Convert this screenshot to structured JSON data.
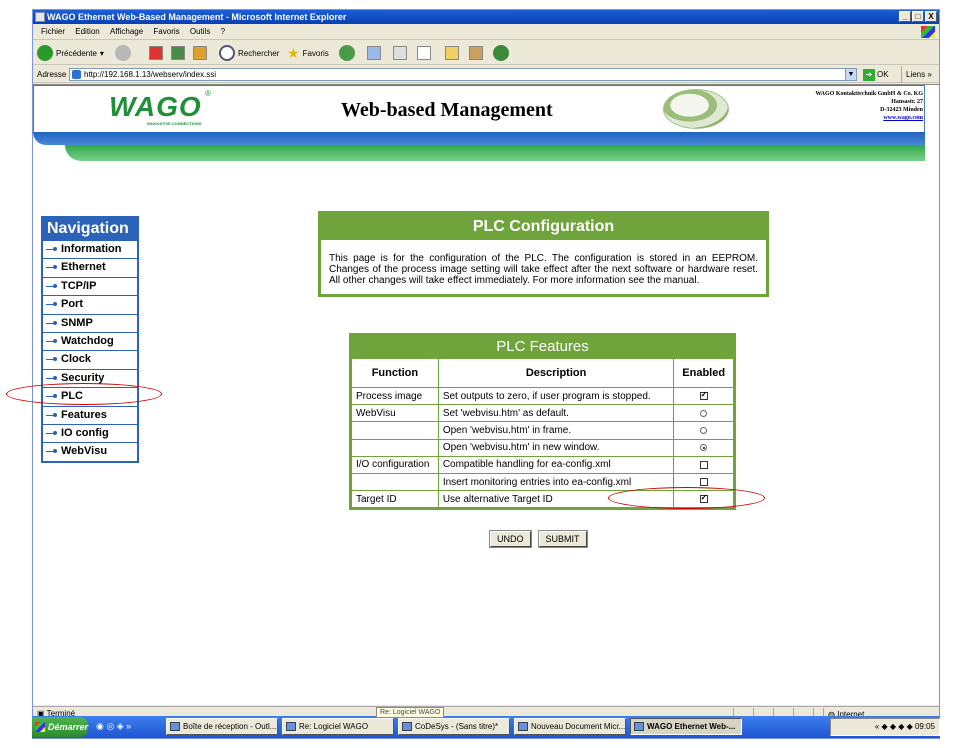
{
  "window": {
    "title": "WAGO Ethernet Web-Based Management - Microsoft Internet Explorer",
    "controls": [
      "_",
      "□",
      "X"
    ]
  },
  "menu": [
    "Fichier",
    "Edition",
    "Affichage",
    "Favoris",
    "Outils",
    "?"
  ],
  "toolbar": {
    "back": "Précédente",
    "search": "Rechercher",
    "favorites": "Favoris"
  },
  "address": {
    "label": "Adresse",
    "url": "http://192.168.1.13/webserv/index.ssi",
    "go": "OK",
    "links": "Liens"
  },
  "header": {
    "logo": "WAGO",
    "logo_sub": "INNOVATIVE CONNECTIONS",
    "registered": "®",
    "title": "Web-based Management",
    "company": "WAGO Kontakttechnik GmbH & Co. KG",
    "street": "Hansastr. 27",
    "city": "D-32423 Minden",
    "web": "www.wago.com"
  },
  "nav": {
    "title": "Navigation",
    "items": [
      "Information",
      "Ethernet",
      "TCP/IP",
      "Port",
      "SNMP",
      "Watchdog",
      "Clock",
      "Security",
      "PLC",
      "Features",
      "IO config",
      "WebVisu"
    ]
  },
  "config": {
    "title": "PLC Configuration",
    "description": "This page is for the configuration of the PLC. The configuration is stored in an EEPROM. Changes of the process image setting will take effect after the next software or hardware reset. All other changes will take effect immediately. For more information see the manual."
  },
  "features": {
    "title": "PLC Features",
    "columns": [
      "Function",
      "Description",
      "Enabled"
    ],
    "rows": [
      {
        "function": "Process image",
        "description": "Set outputs to zero, if user program is stopped.",
        "control": "checkbox",
        "checked": true
      },
      {
        "function": "WebVisu",
        "description": "Set 'webvisu.htm' as default.",
        "control": "radio",
        "checked": false
      },
      {
        "function": "",
        "description": "Open 'webvisu.htm' in frame.",
        "control": "radio",
        "checked": false
      },
      {
        "function": "",
        "description": "Open 'webvisu.htm' in new window.",
        "control": "radio",
        "checked": true
      },
      {
        "function": "I/O configuration",
        "description": "Compatible handling for ea-config.xml",
        "control": "checkbox",
        "checked": false
      },
      {
        "function": "",
        "description": "Insert monitoring entries into ea-config.xml",
        "control": "checkbox",
        "checked": false
      },
      {
        "function": "Target ID",
        "description": "Use alternative Target ID",
        "control": "checkbox",
        "checked": true
      }
    ]
  },
  "buttons": {
    "undo": "UNDO",
    "submit": "SUBMIT"
  },
  "status": {
    "left": "Terminé",
    "zone": "Internet"
  },
  "taskbar": {
    "start": "Démarrer",
    "tooltip": "Re: Logiciel WAGO",
    "tasks": [
      "Boîte de réception - Outl...",
      "Re: Logiciel WAGO",
      "CoDeSys - (Sans titre)*",
      "Nouveau Document Micr...",
      "WAGO Ethernet Web-..."
    ],
    "clock": "09:05"
  },
  "colors": {
    "wago_green": "#6fa33c",
    "nav_blue": "#2c62b8",
    "annotation_red": "#cc0000"
  }
}
